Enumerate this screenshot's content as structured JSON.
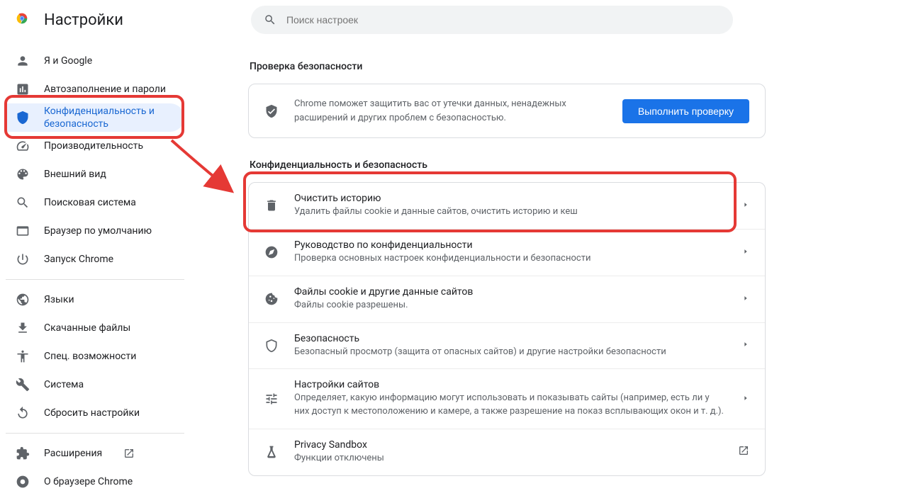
{
  "header": {
    "title": "Настройки",
    "search_placeholder": "Поиск настроек"
  },
  "sidebar": {
    "items": [
      {
        "icon": "person",
        "label": "Я и Google"
      },
      {
        "icon": "autofill",
        "label": "Автозаполнение и пароли"
      },
      {
        "icon": "shield",
        "label": "Конфиденциальность и безопасность",
        "active": true
      },
      {
        "icon": "speed",
        "label": "Производительность"
      },
      {
        "icon": "palette",
        "label": "Внешний вид"
      },
      {
        "icon": "search",
        "label": "Поисковая система"
      },
      {
        "icon": "browser",
        "label": "Браузер по умолчанию"
      },
      {
        "icon": "power",
        "label": "Запуск Chrome"
      }
    ],
    "items2": [
      {
        "icon": "globe",
        "label": "Языки"
      },
      {
        "icon": "download",
        "label": "Скачанные файлы"
      },
      {
        "icon": "accessibility",
        "label": "Спец. возможности"
      },
      {
        "icon": "wrench",
        "label": "Система"
      },
      {
        "icon": "reset",
        "label": "Сбросить настройки"
      }
    ],
    "items3": [
      {
        "icon": "extension",
        "label": "Расширения",
        "external": true
      },
      {
        "icon": "chrome",
        "label": "О браузере Chrome"
      }
    ]
  },
  "safety": {
    "heading": "Проверка безопасности",
    "text": "Chrome поможет защитить вас от утечки данных, ненадежных расширений и других проблем с безопасностью.",
    "button": "Выполнить проверку"
  },
  "privacy": {
    "heading": "Конфиденциальность и безопасность",
    "rows": [
      {
        "icon": "trash",
        "title": "Очистить историю",
        "desc": "Удалить файлы cookie и данные сайтов, очистить историю и кеш",
        "arrow": "chevron"
      },
      {
        "icon": "compass",
        "title": "Руководство по конфиденциальности",
        "desc": "Проверка основных настроек конфиденциальности и безопасности",
        "arrow": "chevron"
      },
      {
        "icon": "cookie",
        "title": "Файлы cookie и другие данные сайтов",
        "desc": "Файлы cookie разрешены.",
        "arrow": "chevron"
      },
      {
        "icon": "shield",
        "title": "Безопасность",
        "desc": "Безопасный просмотр (защита от опасных сайтов) и другие настройки безопасности",
        "arrow": "chevron"
      },
      {
        "icon": "tune",
        "title": "Настройки сайтов",
        "desc": "Определяет, какую информацию могут использовать и показывать сайты (например, есть ли у них доступ к местоположению и камере, а также разрешение на показ всплывающих окон и т. д.).",
        "arrow": "chevron"
      },
      {
        "icon": "flask",
        "title": "Privacy Sandbox",
        "desc": "Функции отключены",
        "arrow": "external"
      }
    ]
  }
}
